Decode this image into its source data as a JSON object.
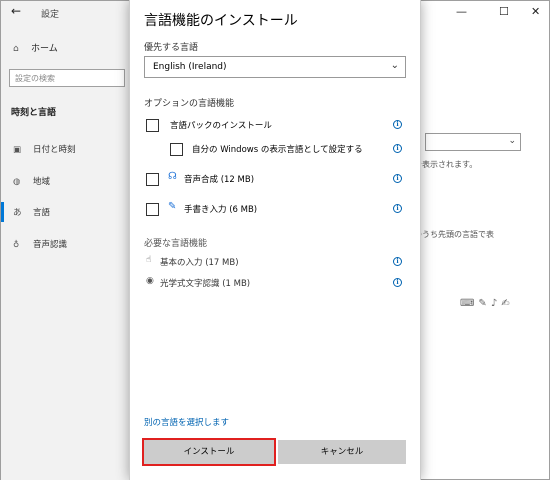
{
  "settings": {
    "app_title": "設定",
    "back_glyph": "←",
    "home_label": "ホーム",
    "search_placeholder": "設定の検索",
    "section_title": "時刻と言語",
    "nav_items": [
      {
        "label": "日付と時刻",
        "icon": "calendar-clock-icon"
      },
      {
        "label": "地域",
        "icon": "globe-icon"
      },
      {
        "label": "言語",
        "icon": "language-icon"
      },
      {
        "label": "音声認識",
        "icon": "microphone-icon"
      }
    ],
    "window_controls": {
      "minimize": "—",
      "maximize": "☐",
      "close": "✕"
    },
    "background_text": {
      "line1": "語で表示されます。",
      "line2": "語のうち先頭の言語で表"
    }
  },
  "dialog": {
    "title": "言語機能のインストール",
    "preferred_language_label": "優先する言語",
    "preferred_language_value": "English (Ireland)",
    "optional_features_label": "オプションの言語機能",
    "optional_features": [
      {
        "label": "言語パックのインストール",
        "checked": false
      },
      {
        "label": "自分の Windows の表示言語として設定する",
        "checked": false
      },
      {
        "label": "音声合成 (12 MB)",
        "checked": false,
        "icon": "speech-icon"
      },
      {
        "label": "手書き入力 (6 MB)",
        "checked": false,
        "icon": "handwriting-icon"
      }
    ],
    "required_features_label": "必要な言語機能",
    "required_features": [
      {
        "label": "基本の入力 (17 MB)",
        "icon": "keyboard-touch-icon"
      },
      {
        "label": "光学式文字認識 (1 MB)",
        "icon": "ocr-icon"
      }
    ],
    "choose_other_link": "別の言語を選択します",
    "install_button": "インストール",
    "cancel_button": "キャンセル",
    "info_glyph": "i"
  }
}
